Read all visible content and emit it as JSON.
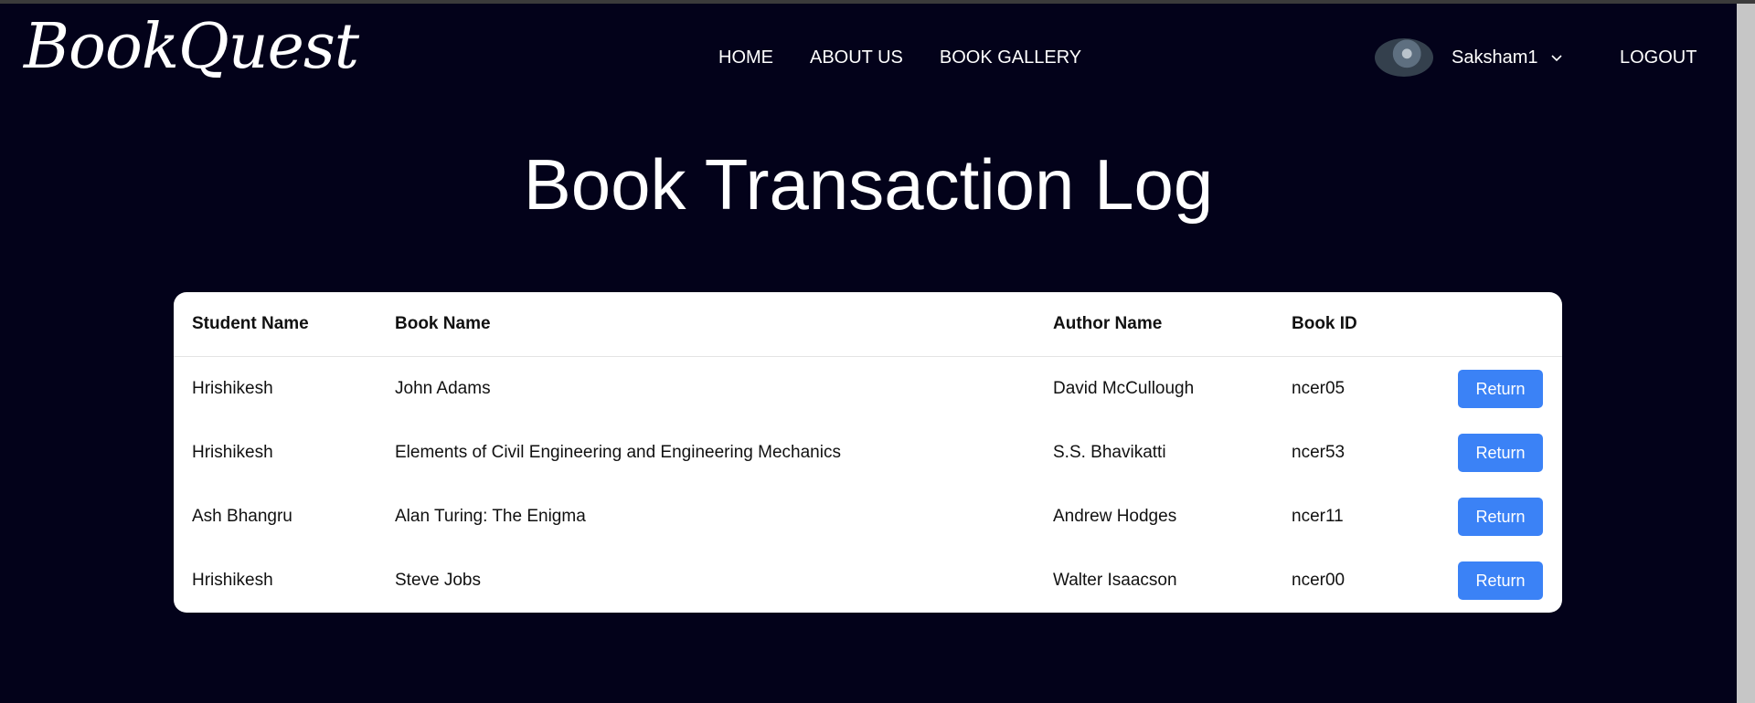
{
  "app": {
    "logo": "BookQuest"
  },
  "nav": {
    "items": [
      "HOME",
      "ABOUT US",
      "BOOK GALLERY"
    ]
  },
  "user": {
    "name": "Saksham1",
    "logout": "LOGOUT"
  },
  "page": {
    "title": "Book Transaction Log"
  },
  "table": {
    "headers": [
      "Student Name",
      "Book Name",
      "Author Name",
      "Book ID"
    ],
    "rows": [
      [
        "Hrishikesh",
        "John Adams",
        "David McCullough",
        "ncer05",
        "Return"
      ],
      [
        "Hrishikesh",
        "Elements of Civil Engineering and Engineering Mechanics",
        "S.S. Bhavikatti",
        "ncer53",
        "Return"
      ],
      [
        "Ash Bhangru",
        "Alan Turing: The Enigma",
        "Andrew Hodges",
        "ncer11",
        "Return"
      ],
      [
        "Hrishikesh",
        "Steve Jobs",
        "Walter Isaacson",
        "ncer00",
        "Return"
      ]
    ]
  },
  "colors": {
    "background": "#03021a",
    "accent": "#3b82f6"
  },
  "icons": {
    "user_menu": "chevron-down-icon"
  }
}
